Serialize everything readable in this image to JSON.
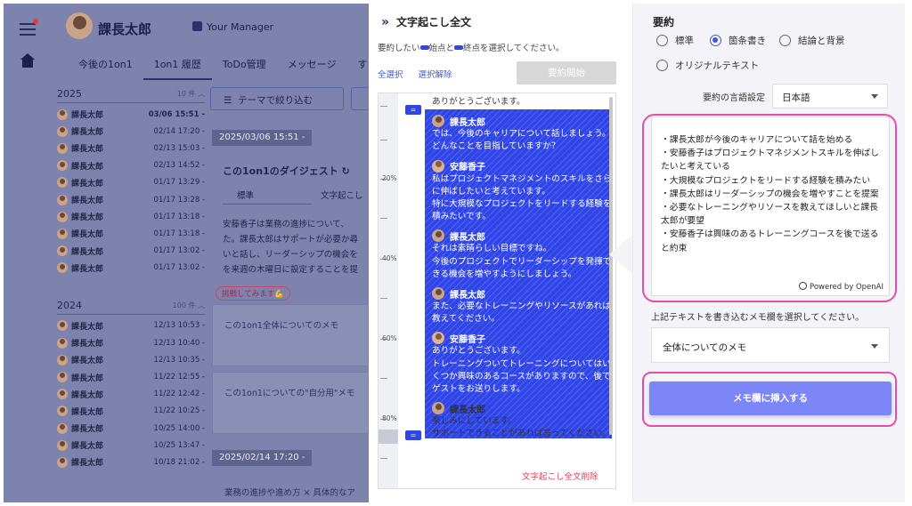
{
  "app": {
    "user_name": "課長太郎",
    "manager_label": "Your Manager",
    "tabs": [
      "今後の1on1",
      "1on1 履歴",
      "ToDo管理",
      "メッセージ",
      "すり"
    ],
    "theme_filter_label": "テーマで絞り込む",
    "years": [
      {
        "year": "2025",
        "count": "10 件",
        "rows": [
          {
            "name": "課長太郎",
            "date": "03/06 15:51 -"
          },
          {
            "name": "課長太郎",
            "date": "02/14 17:20 -"
          },
          {
            "name": "課長太郎",
            "date": "02/13 15:03 -"
          },
          {
            "name": "課長太郎",
            "date": "02/13 14:52 -"
          },
          {
            "name": "課長太郎",
            "date": "01/17 13:29 -"
          },
          {
            "name": "課長太郎",
            "date": "01/17 13:28 -"
          },
          {
            "name": "課長太郎",
            "date": "01/17 13:18 -"
          },
          {
            "name": "課長太郎",
            "date": "01/17 13:18 -"
          },
          {
            "name": "課長太郎",
            "date": "01/17 13:02 -"
          },
          {
            "name": "課長太郎",
            "date": "01/17 13:02 -"
          }
        ]
      },
      {
        "year": "2024",
        "count": "100 件",
        "rows": [
          {
            "name": "課長太郎",
            "date": "12/13 10:53 -"
          },
          {
            "name": "課長太郎",
            "date": "12/13 10:40 -"
          },
          {
            "name": "課長太郎",
            "date": "12/13 10:35 -"
          },
          {
            "name": "課長太郎",
            "date": "11/22 12:55 -"
          },
          {
            "name": "課長太郎",
            "date": "11/22 12:42 -"
          },
          {
            "name": "課長太郎",
            "date": "11/22 10:25 -"
          },
          {
            "name": "課長太郎",
            "date": "10/25 14:00 -"
          },
          {
            "name": "課長太郎",
            "date": "10/25 13:47 -"
          },
          {
            "name": "課長太郎",
            "date": "10/18 21:02 -"
          }
        ]
      }
    ],
    "session_date_1": "2025/03/06 15:51 -",
    "digest_title": "この1on1のダイジェスト",
    "digest_mode": "標準",
    "digest_tab": "文字起こし",
    "digest_text": "安藤香子は業務の進捗について、\nた。課長太郎はサポートが必要か尋\nいと話し、リーダーシップの機会を\nを来週の木曜日に設定することを提",
    "challenge_label": "挑戦してみます💪",
    "memo_overall": "この1on1全体についてのメモ",
    "memo_self": "この1on1についての\"自分用\"メモ",
    "session_date_2": "2025/02/14 17:20 -",
    "memo_next": "業務の進捗や進め方 × 具体的なア"
  },
  "transcript": {
    "title": "文字起こし全文",
    "help_before": "要約したい",
    "help_mid1": "始点と",
    "help_mid2": "終点を選択してください。",
    "select_all": "全選択",
    "deselect": "選択解除",
    "start_summary": "要約開始",
    "timeline_labels": [
      "20%",
      "40%",
      "60%",
      "80%"
    ],
    "delete_label": "文字起こし全文削除",
    "entries": [
      {
        "speaker": "",
        "text": "ありがとうございます。",
        "selected": false
      },
      {
        "speaker": "課長太郎",
        "avatar": "m",
        "text": "では、今後のキャリアについて話しましょう。\nどんなことを目指していますか？",
        "selected": true
      },
      {
        "speaker": "安藤香子",
        "avatar": "f",
        "text": "私はプロジェクトマネジメントのスキルをさらに伸ばしたいと考えています。\n特に大規模なプロジェクトをリードする経験を積みたいです。",
        "selected": true
      },
      {
        "speaker": "課長太郎",
        "avatar": "m",
        "text": "それは素晴らしい目標ですね。\n今後のプロジェクトでリーダーシップを発揮できる機会を増やすようにしましょう。",
        "selected": true
      },
      {
        "speaker": "課長太郎",
        "avatar": "m",
        "text": "また、必要なトレーニングやリソースがあれば教えてください。",
        "selected": true
      },
      {
        "speaker": "安藤香子",
        "avatar": "f",
        "text": "ありがとうございます。\nトレーニングついてトレーニングについてはいくつか興味のあるコースがありますので、後でゲストをお送りします。",
        "selected": true
      },
      {
        "speaker": "課長太郎",
        "avatar": "m",
        "text": "楽しみにしています。\nサポートできることがあれば言ってください。",
        "selected": false
      }
    ]
  },
  "summary": {
    "title": "要約",
    "options": [
      "標準",
      "箇条書き",
      "結論と背景",
      "オリジナルテキスト"
    ],
    "selected_option": "箇条書き",
    "language_label": "要約の言語設定",
    "language_value": "日本語",
    "text": "・課長太郎が今後のキャリアについて話を始める\n・安藤香子はプロジェクトマネジメントスキルを伸ばしたいと考えている\n・大規模なプロジェクトをリードする経験を積みたい\n・課長太郎はリーダーシップの機会を増やすことを提案\n・必要なトレーニングやリソースを教えてほしいと課長太郎が要望\n・安藤香子は興味のあるトレーニングコースを後で送ると約束",
    "powered_by": "Powered by OpenAI",
    "write_label": "上記テキストを書き込むメモ欄を選択してください。",
    "memo_target": "全体についてのメモ",
    "insert_button": "メモ欄に挿入する"
  },
  "colors": {
    "selection_blue": "#2f45e8",
    "highlight_pink": "#e94ca8",
    "insert_button": "#7c86f8"
  }
}
